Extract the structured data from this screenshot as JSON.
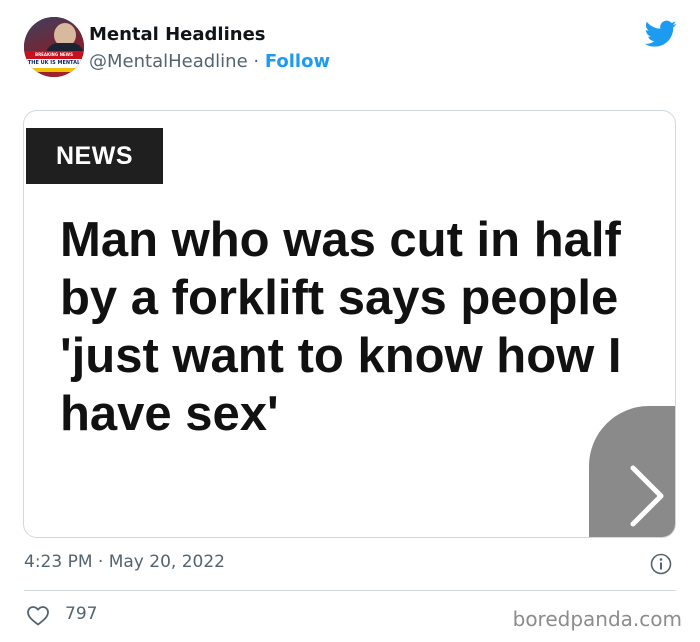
{
  "author": {
    "name": "Mental Headlines",
    "handle": "@MentalHeadline",
    "separator": " · ",
    "follow_label": "Follow",
    "avatar_caption": "THE UK IS MENTAL",
    "avatar_tag": "BREAKING NEWS"
  },
  "media": {
    "tag": "NEWS",
    "headline": "Man who was cut in half by a forklift says people 'just want to know how I have sex'"
  },
  "meta": {
    "timestamp": "4:23 PM · May 20, 2022",
    "likes": "797"
  },
  "watermark": "boredpanda.com",
  "icons": {
    "brand": "twitter-bird-icon",
    "info": "info-icon",
    "like": "heart-icon",
    "next": "chevron-right-icon"
  },
  "colors": {
    "accent": "#1d9bf0",
    "secondary_text": "#536471",
    "border": "#cfd9de",
    "news_tag_bg": "#1f1f1f"
  }
}
